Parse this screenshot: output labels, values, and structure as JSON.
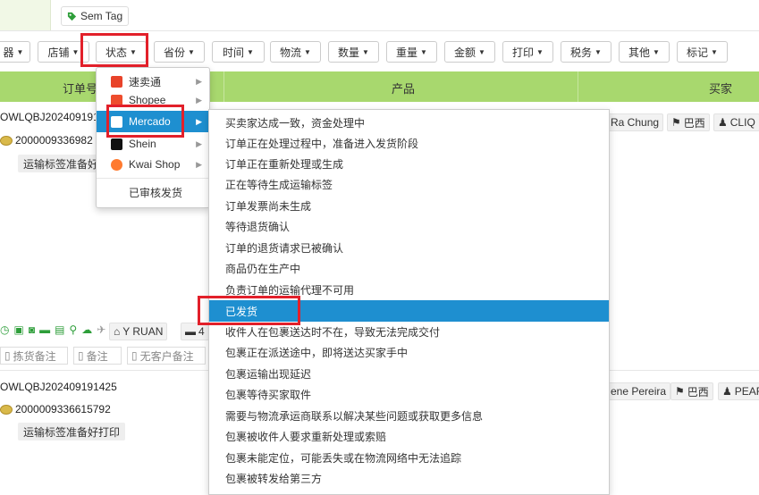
{
  "tagbar": {
    "tag_label": "Sem Tag"
  },
  "filters": [
    {
      "label": "器"
    },
    {
      "label": "店铺"
    },
    {
      "label": "状态"
    },
    {
      "label": "省份"
    },
    {
      "label": "时间"
    },
    {
      "label": "物流"
    },
    {
      "label": "数量"
    },
    {
      "label": "重量"
    },
    {
      "label": "金额"
    },
    {
      "label": "打印"
    },
    {
      "label": "税务"
    },
    {
      "label": "其他"
    },
    {
      "label": "标记"
    }
  ],
  "table": {
    "headers": {
      "order_no": "订单号",
      "product": "产品",
      "buyer": "买家"
    },
    "order1": {
      "id": "OWLQBJ202409191",
      "number": "2000009336982",
      "status_badge": "运输标签准备好",
      "buyer_name": "Ra Chung",
      "country": "巴西",
      "buyer_tag": "CLIQ"
    },
    "actions": {
      "logistics": "Y RUAN",
      "extra": "4"
    },
    "notes": {
      "picking_note": "拣货备注",
      "note": "备注",
      "no_customer_note": "无客户备注"
    },
    "order2": {
      "id": "OWLQBJ202409191425",
      "number": "2000009336615792",
      "status_badge": "运输标签准备好打印",
      "buyer_name": "ene Pereira",
      "country": "巴西",
      "buyer_tag": "PEAR"
    }
  },
  "status_menu": {
    "items": [
      {
        "label": "速卖通",
        "icon": "aliexpress-icon",
        "color": "#e8432a"
      },
      {
        "label": "Shopee",
        "icon": "shopee-icon",
        "color": "#ee4d2d"
      },
      {
        "label": "Mercado",
        "icon": "mercado-icon",
        "color": "#1783c2"
      },
      {
        "label": "Shein",
        "icon": "shein-icon",
        "color": "#111111"
      },
      {
        "label": "Kwai Shop",
        "icon": "kwai-icon",
        "color": "#ff7a2f"
      },
      {
        "label": "已审核发货"
      }
    ]
  },
  "mercado_submenu": {
    "items": [
      "买卖家达成一致，资金处理中",
      "订单正在处理过程中，准备进入发货阶段",
      "订单正在重新处理或生成",
      "正在等待生成运输标签",
      "订单发票尚未生成",
      "等待退货确认",
      "订单的退货请求已被确认",
      "商品仍在生产中",
      "负责订单的运输代理不可用",
      "已发货",
      "收件人在包裹送达时不在，导致无法完成交付",
      "包裹正在派送途中，即将送达买家手中",
      "包裹运输出现延迟",
      "包裹等待买家取件",
      "需要与物流承运商联系以解决某些问题或获取更多信息",
      "包裹被收件人要求重新处理或索赔",
      "包裹未能定位，可能丢失或在物流网络中无法追踪",
      "包裹被转发给第三方"
    ],
    "selected": "已发货"
  },
  "colors": {
    "header_green": "#a8d86e",
    "highlight_blue": "#1e8fd0",
    "annotation_red": "#e2202a"
  }
}
